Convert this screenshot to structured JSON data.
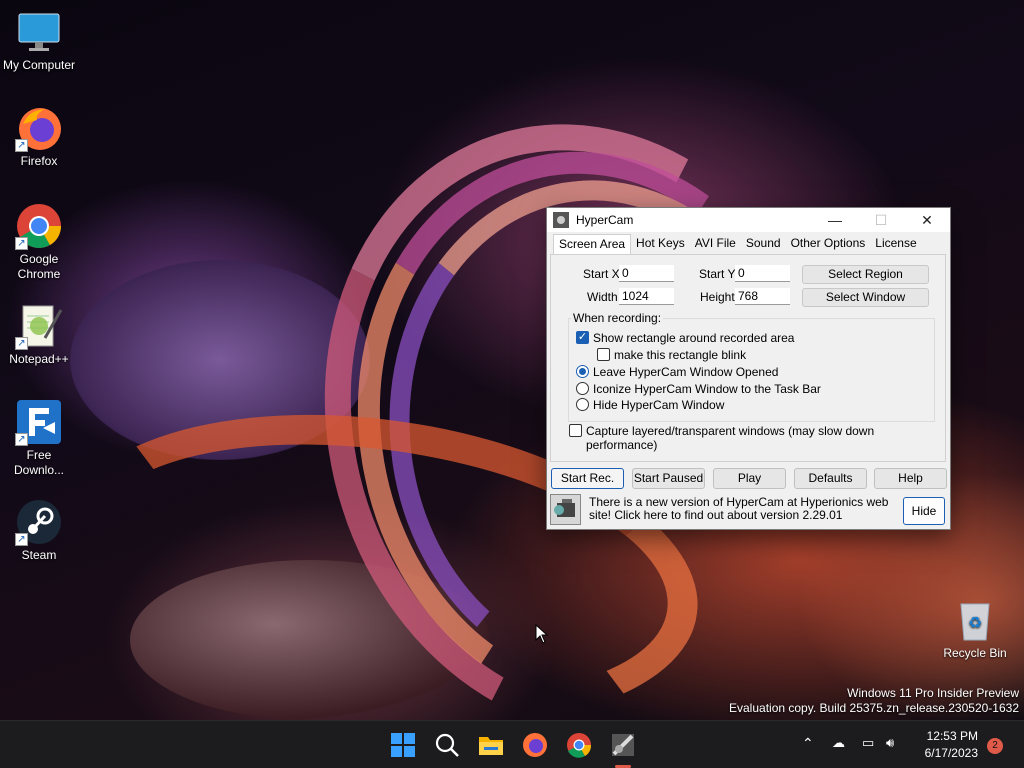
{
  "desktop": {
    "icons": [
      {
        "label": "My Computer",
        "icon": "monitor-icon"
      },
      {
        "label": "Firefox",
        "icon": "firefox-icon"
      },
      {
        "label": "Google Chrome",
        "icon": "chrome-icon"
      },
      {
        "label": "Notepad++",
        "icon": "notepadpp-icon"
      },
      {
        "label": "Free Downlo...",
        "icon": "free-download-manager-icon"
      },
      {
        "label": "Steam",
        "icon": "steam-icon"
      },
      {
        "label": "Recycle Bin",
        "icon": "recycle-bin-icon"
      }
    ],
    "watermark": {
      "line1": "Windows 11 Pro Insider Preview",
      "line2": "Evaluation copy. Build 25375.zn_release.230520-1632"
    }
  },
  "window": {
    "title": "HyperCam",
    "controls": {
      "minimize": "—",
      "maximize": "☐",
      "close": "✕"
    },
    "tabs": [
      "Screen Area",
      "Hot Keys",
      "AVI File",
      "Sound",
      "Other Options",
      "License"
    ],
    "active_tab": "Screen Area",
    "fields": {
      "start_x": {
        "label": "Start X",
        "value": "0"
      },
      "start_y": {
        "label": "Start Y",
        "value": "0"
      },
      "width": {
        "label": "Width",
        "value": "1024"
      },
      "height": {
        "label": "Height",
        "value": "768"
      }
    },
    "buttons": {
      "select_region": "Select Region",
      "select_window": "Select Window"
    },
    "when_recording": {
      "label": "When recording:",
      "show_rect": {
        "label": "Show rectangle around recorded area",
        "checked": true
      },
      "blink": {
        "label": "make this rectangle blink",
        "checked": false
      },
      "leave_opened": {
        "label": "Leave HyperCam Window Opened",
        "selected": true
      },
      "iconize": {
        "label": "Iconize HyperCam Window to the Task Bar",
        "selected": false
      },
      "hide": {
        "label": "Hide HyperCam Window",
        "selected": false
      }
    },
    "capture_layered": {
      "label": "Capture layered/transparent windows (may slow down performance)",
      "checked": false
    },
    "actions": {
      "start_rec": "Start Rec.",
      "start_paused": "Start Paused",
      "play": "Play",
      "defaults": "Defaults",
      "help": "Help"
    },
    "notice": {
      "text": "There is a new version of HyperCam at Hyperionics web site! Click here to find out about version 2.29.01",
      "hide_label": "Hide"
    }
  },
  "taskbar": {
    "apps": [
      "start-icon",
      "search-icon",
      "file-explorer-icon",
      "firefox-icon",
      "chrome-icon",
      "hypercam-icon"
    ],
    "time": "12:53 PM",
    "date": "6/17/2023",
    "notification_count": "2",
    "colors": {
      "accent": "#1a5fb4",
      "notification": "#e05a4a"
    }
  }
}
